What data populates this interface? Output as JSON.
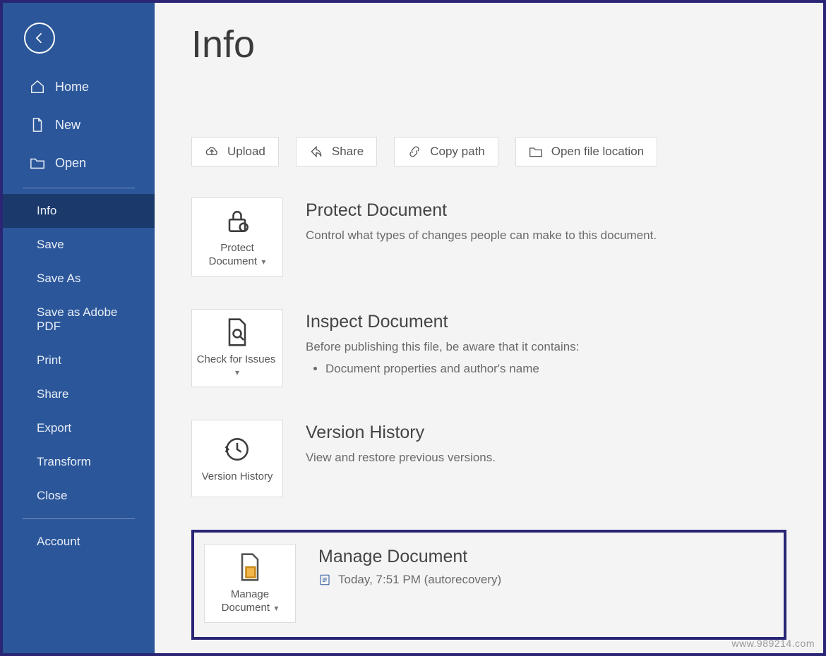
{
  "page": {
    "title": "Info"
  },
  "sidebar": {
    "top": [
      {
        "label": "Home"
      },
      {
        "label": "New"
      },
      {
        "label": "Open"
      }
    ],
    "mid": [
      {
        "label": "Info",
        "selected": true
      },
      {
        "label": "Save"
      },
      {
        "label": "Save As"
      },
      {
        "label": "Save as Adobe PDF"
      },
      {
        "label": "Print"
      },
      {
        "label": "Share"
      },
      {
        "label": "Export"
      },
      {
        "label": "Transform"
      },
      {
        "label": "Close"
      }
    ],
    "bottom": [
      {
        "label": "Account"
      }
    ]
  },
  "actions": {
    "upload": "Upload",
    "share": "Share",
    "copy_path": "Copy path",
    "open_location": "Open file location"
  },
  "sections": {
    "protect": {
      "tile": "Protect Document",
      "title": "Protect Document",
      "desc": "Control what types of changes people can make to this document."
    },
    "inspect": {
      "tile": "Check for Issues",
      "title": "Inspect Document",
      "desc": "Before publishing this file, be aware that it contains:",
      "bullet1": "Document properties and author's name"
    },
    "history": {
      "tile": "Version History",
      "title": "Version History",
      "desc": "View and restore previous versions."
    },
    "manage": {
      "tile": "Manage Document",
      "title": "Manage Document",
      "version_text": "Today, 7:51 PM (autorecovery)"
    }
  },
  "watermark": "www.989214.com"
}
